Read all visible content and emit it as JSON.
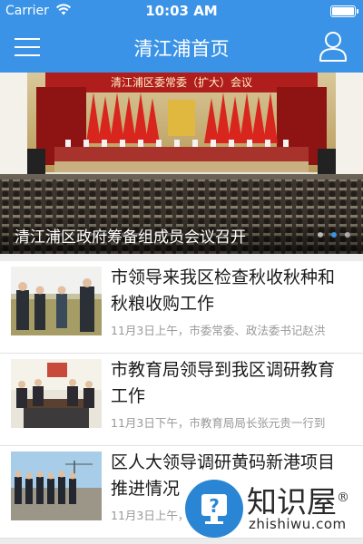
{
  "status_bar": {
    "carrier": "Carrier",
    "time": "10:03 AM",
    "wifi_icon": "wifi-icon",
    "battery_icon": "battery-icon"
  },
  "nav_bar": {
    "title": "清江浦首页",
    "menu_icon": "hamburger-menu-icon",
    "user_icon": "user-profile-icon",
    "background_color": "#3a93e6"
  },
  "banner": {
    "image_text": "清江浦区委常委（扩大）会议",
    "caption": "清江浦区政府筹备组成员会议召开",
    "slide_count": 3,
    "active_slide": 2
  },
  "news": [
    {
      "title": "市领导来我区检查秋收秋种和秋粮收购工作",
      "summary": "11月3日上午，市委常委、政法委书记赵洪"
    },
    {
      "title": "市教育局领导到我区调研教育工作",
      "summary": "11月3日下午，市教育局局长张元贵一行到"
    },
    {
      "title": "区人大领导调研黄码新港项目推进情况",
      "summary": "11月3日上午，"
    }
  ],
  "watermark": {
    "brand": "知识屋",
    "registered": "®",
    "url": "zhishiwu.com"
  }
}
